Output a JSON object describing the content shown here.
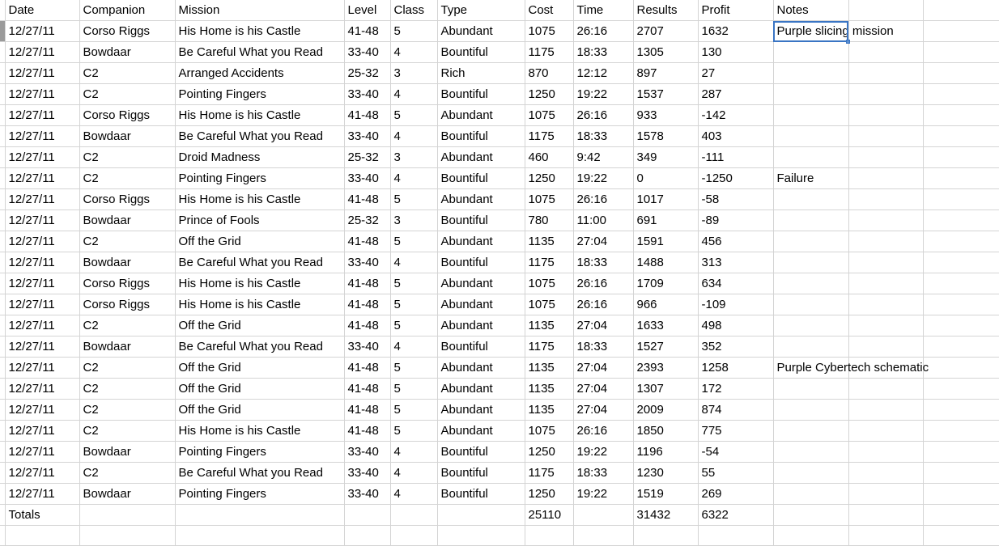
{
  "app": {
    "kind": "spreadsheet"
  },
  "colors": {
    "grid_line": "#d4d4d4",
    "selection_border": "#3a75c4",
    "selection_handle": "#5b8fd0",
    "row_header_active": "#9a9a9a",
    "text": "#000000",
    "background": "#ffffff"
  },
  "columns": [
    {
      "key": "date",
      "label": "Date"
    },
    {
      "key": "comp",
      "label": "Companion"
    },
    {
      "key": "mission",
      "label": "Mission"
    },
    {
      "key": "level",
      "label": "Level"
    },
    {
      "key": "class",
      "label": "Class"
    },
    {
      "key": "type",
      "label": "Type"
    },
    {
      "key": "cost",
      "label": "Cost"
    },
    {
      "key": "time",
      "label": "Time"
    },
    {
      "key": "results",
      "label": "Results"
    },
    {
      "key": "profit",
      "label": "Profit"
    },
    {
      "key": "notes",
      "label": "Notes"
    },
    {
      "key": "extra1",
      "label": ""
    },
    {
      "key": "extra2",
      "label": ""
    }
  ],
  "selection": {
    "column": "notes",
    "row_index": 0,
    "value": "Purple slicing mission"
  },
  "rows": [
    {
      "date": "12/27/11",
      "comp": "Corso Riggs",
      "mission": "His Home is his Castle",
      "level": "41-48",
      "class": "5",
      "type": "Abundant",
      "cost": "1075",
      "time": "26:16",
      "results": "2707",
      "profit": "1632",
      "notes": "Purple slicing mission"
    },
    {
      "date": "12/27/11",
      "comp": "Bowdaar",
      "mission": "Be Careful What you Read",
      "level": "33-40",
      "class": "4",
      "type": "Bountiful",
      "cost": "1175",
      "time": "18:33",
      "results": "1305",
      "profit": "130",
      "notes": ""
    },
    {
      "date": "12/27/11",
      "comp": "C2",
      "mission": "Arranged Accidents",
      "level": "25-32",
      "class": "3",
      "type": "Rich",
      "cost": "870",
      "time": "12:12",
      "results": "897",
      "profit": "27",
      "notes": ""
    },
    {
      "date": "12/27/11",
      "comp": "C2",
      "mission": "Pointing Fingers",
      "level": "33-40",
      "class": "4",
      "type": "Bountiful",
      "cost": "1250",
      "time": "19:22",
      "results": "1537",
      "profit": "287",
      "notes": ""
    },
    {
      "date": "12/27/11",
      "comp": "Corso Riggs",
      "mission": "His Home is his Castle",
      "level": "41-48",
      "class": "5",
      "type": "Abundant",
      "cost": "1075",
      "time": "26:16",
      "results": "933",
      "profit": "-142",
      "notes": ""
    },
    {
      "date": "12/27/11",
      "comp": "Bowdaar",
      "mission": "Be Careful What you Read",
      "level": "33-40",
      "class": "4",
      "type": "Bountiful",
      "cost": "1175",
      "time": "18:33",
      "results": "1578",
      "profit": "403",
      "notes": ""
    },
    {
      "date": "12/27/11",
      "comp": "C2",
      "mission": "Droid Madness",
      "level": "25-32",
      "class": "3",
      "type": "Abundant",
      "cost": "460",
      "time": "9:42",
      "results": "349",
      "profit": "-111",
      "notes": ""
    },
    {
      "date": "12/27/11",
      "comp": "C2",
      "mission": "Pointing Fingers",
      "level": "33-40",
      "class": "4",
      "type": "Bountiful",
      "cost": "1250",
      "time": "19:22",
      "results": "0",
      "profit": "-1250",
      "notes": "Failure"
    },
    {
      "date": "12/27/11",
      "comp": "Corso Riggs",
      "mission": "His Home is his Castle",
      "level": "41-48",
      "class": "5",
      "type": "Abundant",
      "cost": "1075",
      "time": "26:16",
      "results": "1017",
      "profit": "-58",
      "notes": ""
    },
    {
      "date": "12/27/11",
      "comp": "Bowdaar",
      "mission": "Prince of Fools",
      "level": "25-32",
      "class": "3",
      "type": "Bountiful",
      "cost": "780",
      "time": "11:00",
      "results": "691",
      "profit": "-89",
      "notes": ""
    },
    {
      "date": "12/27/11",
      "comp": "C2",
      "mission": "Off the Grid",
      "level": "41-48",
      "class": "5",
      "type": "Abundant",
      "cost": "1135",
      "time": "27:04",
      "results": "1591",
      "profit": "456",
      "notes": ""
    },
    {
      "date": "12/27/11",
      "comp": "Bowdaar",
      "mission": "Be Careful What you Read",
      "level": "33-40",
      "class": "4",
      "type": "Bountiful",
      "cost": "1175",
      "time": "18:33",
      "results": "1488",
      "profit": "313",
      "notes": ""
    },
    {
      "date": "12/27/11",
      "comp": "Corso Riggs",
      "mission": "His Home is his Castle",
      "level": "41-48",
      "class": "5",
      "type": "Abundant",
      "cost": "1075",
      "time": "26:16",
      "results": "1709",
      "profit": "634",
      "notes": ""
    },
    {
      "date": "12/27/11",
      "comp": "Corso Riggs",
      "mission": "His Home is his Castle",
      "level": "41-48",
      "class": "5",
      "type": "Abundant",
      "cost": "1075",
      "time": "26:16",
      "results": "966",
      "profit": "-109",
      "notes": ""
    },
    {
      "date": "12/27/11",
      "comp": "C2",
      "mission": "Off the Grid",
      "level": "41-48",
      "class": "5",
      "type": "Abundant",
      "cost": "1135",
      "time": "27:04",
      "results": "1633",
      "profit": "498",
      "notes": ""
    },
    {
      "date": "12/27/11",
      "comp": "Bowdaar",
      "mission": "Be Careful What you Read",
      "level": "33-40",
      "class": "4",
      "type": "Bountiful",
      "cost": "1175",
      "time": "18:33",
      "results": "1527",
      "profit": "352",
      "notes": ""
    },
    {
      "date": "12/27/11",
      "comp": "C2",
      "mission": "Off the Grid",
      "level": "41-48",
      "class": "5",
      "type": "Abundant",
      "cost": "1135",
      "time": "27:04",
      "results": "2393",
      "profit": "1258",
      "notes": "Purple Cybertech schematic"
    },
    {
      "date": "12/27/11",
      "comp": "C2",
      "mission": "Off the Grid",
      "level": "41-48",
      "class": "5",
      "type": "Abundant",
      "cost": "1135",
      "time": "27:04",
      "results": "1307",
      "profit": "172",
      "notes": ""
    },
    {
      "date": "12/27/11",
      "comp": "C2",
      "mission": "Off the Grid",
      "level": "41-48",
      "class": "5",
      "type": "Abundant",
      "cost": "1135",
      "time": "27:04",
      "results": "2009",
      "profit": "874",
      "notes": ""
    },
    {
      "date": "12/27/11",
      "comp": "C2",
      "mission": "His Home is his Castle",
      "level": "41-48",
      "class": "5",
      "type": "Abundant",
      "cost": "1075",
      "time": "26:16",
      "results": "1850",
      "profit": "775",
      "notes": ""
    },
    {
      "date": "12/27/11",
      "comp": "Bowdaar",
      "mission": "Pointing Fingers",
      "level": "33-40",
      "class": "4",
      "type": "Bountiful",
      "cost": "1250",
      "time": "19:22",
      "results": "1196",
      "profit": "-54",
      "notes": ""
    },
    {
      "date": "12/27/11",
      "comp": "C2",
      "mission": "Be Careful What you Read",
      "level": "33-40",
      "class": "4",
      "type": "Bountiful",
      "cost": "1175",
      "time": "18:33",
      "results": "1230",
      "profit": "55",
      "notes": ""
    },
    {
      "date": "12/27/11",
      "comp": "Bowdaar",
      "mission": "Pointing Fingers",
      "level": "33-40",
      "class": "4",
      "type": "Bountiful",
      "cost": "1250",
      "time": "19:22",
      "results": "1519",
      "profit": "269",
      "notes": ""
    }
  ],
  "totals": {
    "date": "Totals",
    "comp": "",
    "mission": "",
    "level": "",
    "class": "",
    "type": "",
    "cost": "25110",
    "time": "",
    "results": "31432",
    "profit": "6322",
    "notes": ""
  }
}
